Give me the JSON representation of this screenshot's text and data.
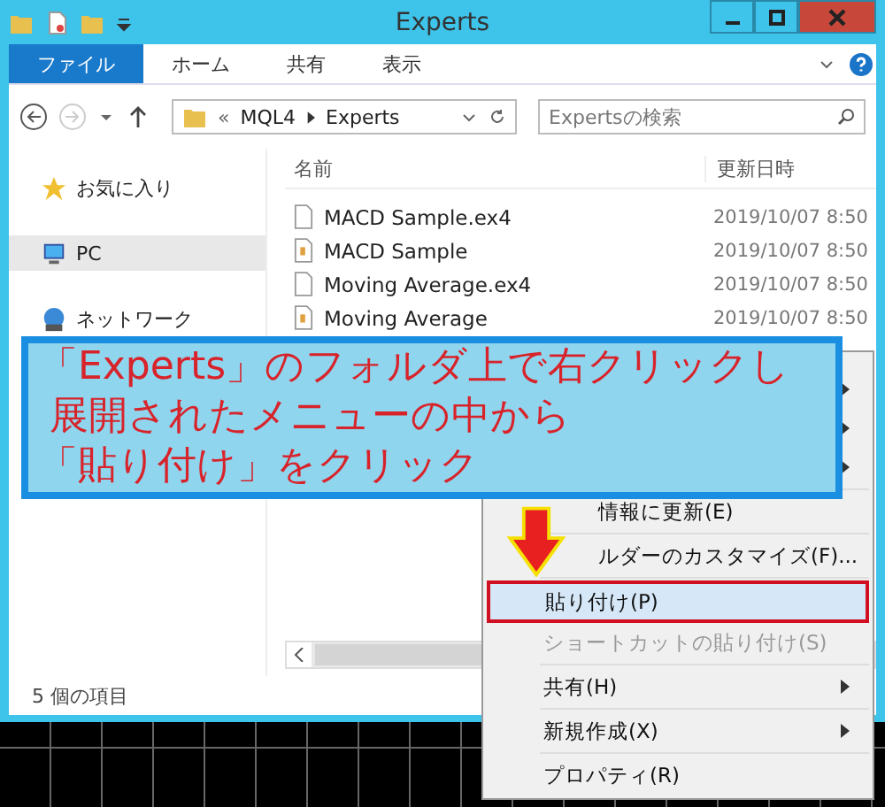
{
  "window": {
    "title": "Experts"
  },
  "ribbon_tabs": [
    {
      "label": "ファイル",
      "selected": true
    },
    {
      "label": "ホーム",
      "selected": false
    },
    {
      "label": "共有",
      "selected": false
    },
    {
      "label": "表示",
      "selected": false
    }
  ],
  "address": {
    "parent": "«",
    "path": [
      "MQL4",
      "Experts"
    ]
  },
  "search": {
    "placeholder": "Expertsの検索"
  },
  "sidebar": {
    "items": [
      {
        "label": "お気に入り",
        "selected": false
      },
      {
        "label": "PC",
        "selected": true
      },
      {
        "label": "ネットワーク",
        "selected": false
      }
    ]
  },
  "table": {
    "columns": [
      "名前",
      "更新日時"
    ],
    "rows": [
      {
        "name": "MACD Sample.ex4",
        "kind": "file",
        "modified": "2019/10/07 8:50"
      },
      {
        "name": "MACD Sample",
        "kind": "source",
        "modified": "2019/10/07 8:50"
      },
      {
        "name": "Moving Average.ex4",
        "kind": "file",
        "modified": "2019/10/07 8:50"
      },
      {
        "name": "Moving Average",
        "kind": "source",
        "modified": "2019/10/07 8:50"
      }
    ]
  },
  "status_bar": "5 個の項目",
  "callout": {
    "lines": [
      "「Experts」のフォルダ上で右クリックし",
      "展開されたメニューの中から",
      "「貼り付け」をクリック"
    ]
  },
  "context_menu": [
    {
      "kind": "item",
      "submenu": true,
      "selected": false,
      "disabled": false
    },
    {
      "kind": "item",
      "submenu": true,
      "selected": false,
      "disabled": false
    },
    {
      "kind": "item",
      "submenu": true,
      "selected": false,
      "disabled": false
    },
    {
      "kind": "separator"
    },
    {
      "kind": "partial",
      "label": "情報に更新(E)",
      "submenu": false,
      "selected": false,
      "disabled": false
    },
    {
      "kind": "separator"
    },
    {
      "kind": "partial",
      "label": "ルダーのカスタマイズ(F)...",
      "submenu": false,
      "selected": false,
      "disabled": false
    },
    {
      "kind": "separator"
    },
    {
      "kind": "item",
      "label": "貼り付け(P)",
      "submenu": false,
      "selected": true,
      "disabled": false
    },
    {
      "kind": "item",
      "label": "ショートカットの貼り付け(S)",
      "submenu": false,
      "selected": false,
      "disabled": true
    },
    {
      "kind": "separator"
    },
    {
      "kind": "item",
      "label": "共有(H)",
      "submenu": true,
      "selected": false,
      "disabled": false
    },
    {
      "kind": "separator"
    },
    {
      "kind": "item",
      "label": "新規作成(X)",
      "submenu": true,
      "selected": false,
      "disabled": false
    },
    {
      "kind": "separator"
    },
    {
      "kind": "item",
      "label": "プロパティ(R)",
      "submenu": false,
      "selected": false,
      "disabled": false
    }
  ]
}
